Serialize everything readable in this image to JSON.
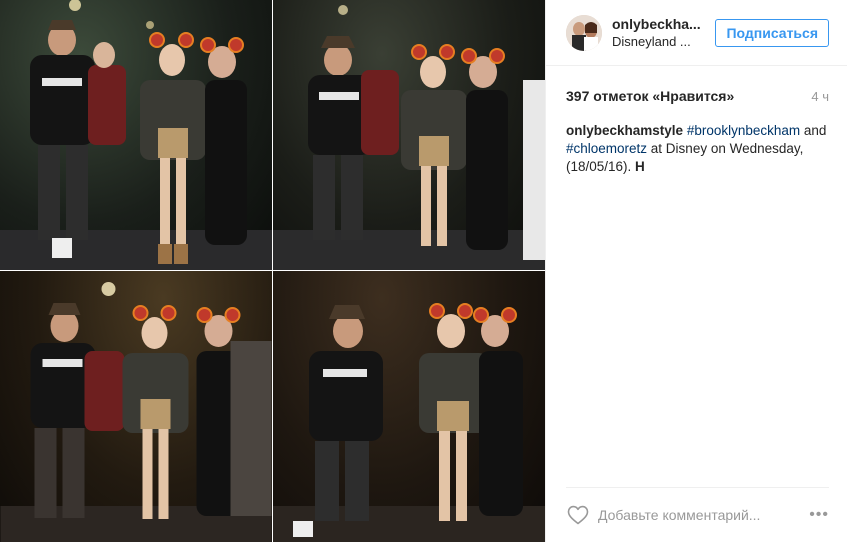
{
  "post": {
    "author": {
      "username": "onlybeckha...",
      "location": "Disneyland ...",
      "follow_label": "Подписаться"
    },
    "likes_text": "397 отметок «Нравится»",
    "time_ago": "4 ч",
    "caption": {
      "author": "onlybeckhamstyle",
      "hashtag_1": "#brooklynbeckham",
      "and": " and ",
      "hashtag_2": "#chloemoretz",
      "text": " at Disney on Wednesday, (18/05/16). ",
      "glyph": "H"
    },
    "comment": {
      "placeholder": "Добавьте комментарий..."
    },
    "more_label": "•••"
  },
  "colors": {
    "follow_blue": "#3897f0",
    "hashtag": "#003569",
    "muted": "#999999",
    "text": "#262626"
  },
  "icons": [
    "heart-icon",
    "more-icon"
  ]
}
